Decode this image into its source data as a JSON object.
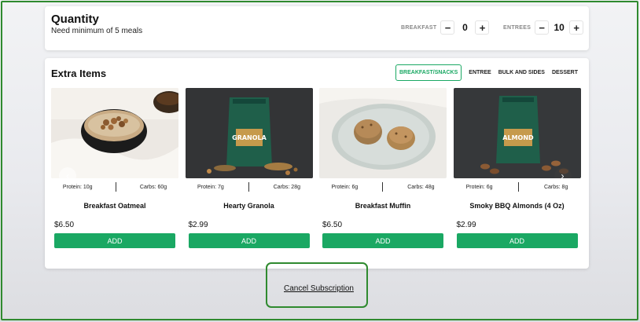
{
  "quantity": {
    "title": "Quantity",
    "subtitle": "Need minimum of 5 meals",
    "breakfast": {
      "label": "BREAKFAST",
      "value": "0",
      "minus": "−",
      "plus": "+"
    },
    "entrees": {
      "label": "ENTREES",
      "value": "10",
      "minus": "−",
      "plus": "+"
    }
  },
  "extras": {
    "title": "Extra Items",
    "tabs": [
      {
        "label": "BREAKFAST/SNACKS",
        "active": true
      },
      {
        "label": "ENTREE",
        "active": false
      },
      {
        "label": "BULK AND SIDES",
        "active": false
      },
      {
        "label": "DESSERT",
        "active": false
      }
    ],
    "products": [
      {
        "name": "Breakfast Oatmeal",
        "protein": "Protein: 10g",
        "carbs": "Carbs: 60g",
        "price": "$6.50",
        "add": "ADD"
      },
      {
        "name": "Hearty Granola",
        "protein": "Protein: 7g",
        "carbs": "Carbs: 28g",
        "price": "$2.99",
        "add": "ADD",
        "bag_text": "GRANOLA"
      },
      {
        "name": "Breakfast Muffin",
        "protein": "Protein: 6g",
        "carbs": "Carbs: 48g",
        "price": "$6.50",
        "add": "ADD"
      },
      {
        "name": "Smoky BBQ Almonds (4 Oz)",
        "protein": "Protein: 6g",
        "carbs": "Carbs: 8g",
        "price": "$2.99",
        "add": "ADD",
        "bag_text": "ALMOND"
      }
    ],
    "prev_icon": "‹",
    "next_icon": "›"
  },
  "cancel": {
    "label": "Cancel Subscription"
  },
  "colors": {
    "accent": "#1aa863",
    "highlight": "#2f8a2f"
  }
}
